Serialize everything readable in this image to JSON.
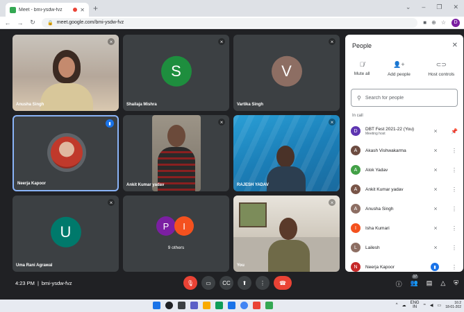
{
  "browser": {
    "tab_title": "Meet - bmi-ysdw-fvz",
    "tab_close": "✕",
    "new_tab": "+",
    "url": "meet.google.com/bmi-ysdw-fvz",
    "profile_initial": "D"
  },
  "tiles": [
    {
      "name": "Anusha Singh",
      "type": "photo"
    },
    {
      "name": "Shailaja Mishra",
      "initial": "S",
      "color": "#1e8e3e"
    },
    {
      "name": "Vartika Singh",
      "initial": "V",
      "color": "#8d6e63"
    },
    {
      "name": "Neerja Kapoor",
      "type": "photo"
    },
    {
      "name": "Ankit Kumar yadav",
      "type": "photo"
    },
    {
      "name": "RAJESH YADAV",
      "type": "photo"
    },
    {
      "name": "Uma Rani Agrawal",
      "initial": "U",
      "color": "#00796b"
    },
    {
      "name": "9 others",
      "initials": [
        "P",
        "I"
      ]
    },
    {
      "name": "You",
      "type": "photo"
    }
  ],
  "bottom_bar": {
    "time": "4:23 PM",
    "separator": "|",
    "meeting_code": "bmi-ysdw-fvz",
    "participant_count": "17"
  },
  "people_panel": {
    "title": "People",
    "actions": {
      "mute_all": "Mute all",
      "add_people": "Add people",
      "host_controls": "Host controls"
    },
    "search_placeholder": "Search for people",
    "section": "In call",
    "participants": [
      {
        "initial": "D",
        "color": "#5e35b1",
        "name": "DBT Fest 2021-22 (You)",
        "sub": "Meeting host"
      },
      {
        "initial": "A",
        "color": "#6d4c41",
        "name": "Akash Vishwakarma"
      },
      {
        "initial": "A",
        "color": "#43a047",
        "name": "Alok Yadav"
      },
      {
        "initial": "A",
        "color": "#795548",
        "name": "Ankit Kumar yadav"
      },
      {
        "initial": "A",
        "color": "#8d6e63",
        "name": "Anusha Singh"
      },
      {
        "initial": "I",
        "color": "#f4511e",
        "name": "Isha Kumari"
      },
      {
        "initial": "L",
        "color": "#8d6e63",
        "name": "Lailesh"
      },
      {
        "initial": "N",
        "color": "#c62828",
        "name": "Neerja Kapoor"
      }
    ]
  },
  "taskbar": {
    "lang": "ENG",
    "lang_sub": "IN",
    "time": "16:2",
    "date": "18-01-202"
  }
}
